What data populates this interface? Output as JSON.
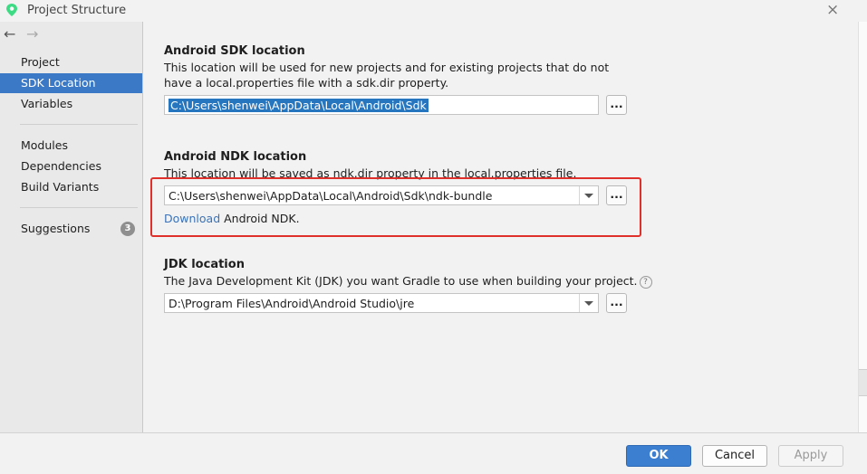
{
  "window": {
    "title": "Project Structure",
    "close_icon": "close-icon",
    "app_icon": "android-studio-icon",
    "accent_color": "#3b78c6"
  },
  "navigation": {
    "back_icon": "arrow-left-icon",
    "forward_icon": "arrow-right-icon"
  },
  "sidebar": {
    "items": [
      {
        "label": "Project",
        "selected": false
      },
      {
        "label": "SDK Location",
        "selected": true
      },
      {
        "label": "Variables",
        "selected": false
      },
      {
        "label": "Modules",
        "selected": false
      },
      {
        "label": "Dependencies",
        "selected": false
      },
      {
        "label": "Build Variants",
        "selected": false
      },
      {
        "label": "Suggestions",
        "selected": false,
        "badge": "3"
      }
    ]
  },
  "sdk": {
    "title": "Android SDK location",
    "description": "This location will be used for new projects and for existing projects that do not have a local.properties file with a sdk.dir property.",
    "value": "C:\\Users\\shenwei\\AppData\\Local\\Android\\Sdk",
    "browse_label": "..."
  },
  "ndk": {
    "title": "Android NDK location",
    "description": "This location will be saved as ndk.dir property in the local.properties file.",
    "value": "C:\\Users\\shenwei\\AppData\\Local\\Android\\Sdk\\ndk-bundle",
    "browse_label": "...",
    "download_link": "Download",
    "download_suffix": "Android NDK.",
    "highlight_color": "#e0302b"
  },
  "jdk": {
    "title": "JDK location",
    "description": "The Java Development Kit (JDK) you want Gradle to use when building your project.",
    "help_symbol": "?",
    "value": "D:\\Program Files\\Android\\Android Studio\\jre",
    "browse_label": "..."
  },
  "footer": {
    "ok_label": "OK",
    "cancel_label": "Cancel",
    "apply_label": "Apply",
    "apply_enabled": false
  }
}
